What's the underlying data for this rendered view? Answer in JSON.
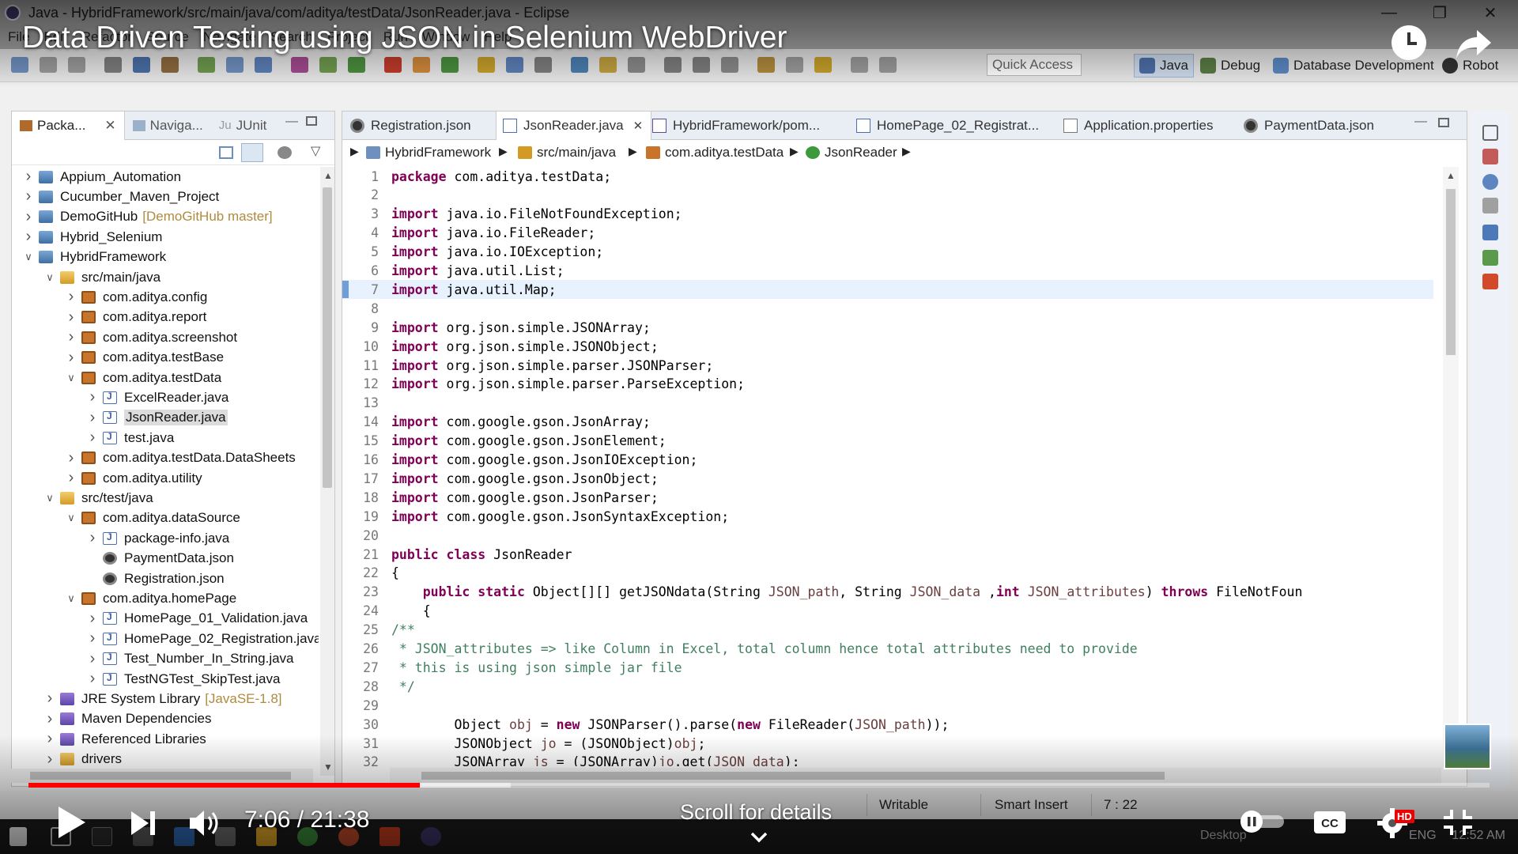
{
  "window": {
    "title": "Java - HybridFramework/src/main/java/com/aditya/testData/JsonReader.java - Eclipse"
  },
  "menu": [
    "File",
    "Edit",
    "Refactor",
    "Source",
    "Navigate",
    "Search",
    "Project",
    "Run",
    "Window",
    "Help"
  ],
  "toolbar": {
    "quick_access_placeholder": "Quick Access",
    "perspectives": [
      "Java",
      "Debug",
      "Database Development",
      "Robot"
    ]
  },
  "left_panel": {
    "tabs": [
      "Packa...",
      "Naviga...",
      "JUnit"
    ],
    "tree": [
      {
        "label": "Appium_Automation",
        "icon": "project-icon",
        "depth": 0,
        "twisty": "collapsed"
      },
      {
        "label": "Cucumber_Maven_Project",
        "icon": "project-icon",
        "depth": 0,
        "twisty": "collapsed"
      },
      {
        "label": "DemoGitHub",
        "decor": "[DemoGitHub master]",
        "icon": "project-icon",
        "depth": 0,
        "twisty": "collapsed"
      },
      {
        "label": "Hybrid_Selenium",
        "icon": "project-icon",
        "depth": 0,
        "twisty": "collapsed"
      },
      {
        "label": "HybridFramework",
        "icon": "project-icon",
        "depth": 0,
        "twisty": "expanded"
      },
      {
        "label": "src/main/java",
        "icon": "folder-icon",
        "depth": 1,
        "twisty": "expanded"
      },
      {
        "label": "com.aditya.config",
        "icon": "package-icon",
        "depth": 2,
        "twisty": "collapsed"
      },
      {
        "label": "com.aditya.report",
        "icon": "package-icon",
        "depth": 2,
        "twisty": "collapsed"
      },
      {
        "label": "com.aditya.screenshot",
        "icon": "package-icon",
        "depth": 2,
        "twisty": "collapsed"
      },
      {
        "label": "com.aditya.testBase",
        "icon": "package-icon",
        "depth": 2,
        "twisty": "collapsed"
      },
      {
        "label": "com.aditya.testData",
        "icon": "package-icon",
        "depth": 2,
        "twisty": "expanded"
      },
      {
        "label": "ExcelReader.java",
        "icon": "java-file-icon",
        "depth": 3,
        "twisty": "collapsed"
      },
      {
        "label": "JsonReader.java",
        "icon": "java-file-icon",
        "depth": 3,
        "twisty": "collapsed",
        "selected": true
      },
      {
        "label": "test.java",
        "icon": "java-file-icon",
        "depth": 3,
        "twisty": "collapsed"
      },
      {
        "label": "com.aditya.testData.DataSheets",
        "icon": "package-icon",
        "depth": 2,
        "twisty": "collapsed"
      },
      {
        "label": "com.aditya.utility",
        "icon": "package-icon",
        "depth": 2,
        "twisty": "collapsed"
      },
      {
        "label": "src/test/java",
        "icon": "folder-icon",
        "depth": 1,
        "twisty": "expanded"
      },
      {
        "label": "com.aditya.dataSource",
        "icon": "package-icon",
        "depth": 2,
        "twisty": "expanded"
      },
      {
        "label": "package-info.java",
        "icon": "java-file-icon",
        "depth": 3,
        "twisty": "collapsed"
      },
      {
        "label": "PaymentData.json",
        "icon": "json-file-icon",
        "depth": 3,
        "twisty": "none"
      },
      {
        "label": "Registration.json",
        "icon": "json-file-icon",
        "depth": 3,
        "twisty": "none"
      },
      {
        "label": "com.aditya.homePage",
        "icon": "package-icon",
        "depth": 2,
        "twisty": "expanded"
      },
      {
        "label": "HomePage_01_Validation.java",
        "icon": "java-file-icon",
        "depth": 3,
        "twisty": "collapsed"
      },
      {
        "label": "HomePage_02_Registration.java",
        "icon": "java-file-icon",
        "depth": 3,
        "twisty": "collapsed"
      },
      {
        "label": "Test_Number_In_String.java",
        "icon": "java-file-icon",
        "depth": 3,
        "twisty": "collapsed"
      },
      {
        "label": "TestNGTest_SkipTest.java",
        "icon": "java-file-icon",
        "depth": 3,
        "twisty": "collapsed"
      },
      {
        "label": "JRE System Library",
        "decor": "[JavaSE-1.8]",
        "icon": "library-icon",
        "depth": 1,
        "twisty": "collapsed"
      },
      {
        "label": "Maven Dependencies",
        "icon": "library-icon",
        "depth": 1,
        "twisty": "collapsed"
      },
      {
        "label": "Referenced Libraries",
        "icon": "library-icon",
        "depth": 1,
        "twisty": "collapsed"
      },
      {
        "label": "drivers",
        "icon": "folder-icon",
        "depth": 1,
        "twisty": "collapsed"
      }
    ]
  },
  "editor": {
    "tabs": [
      {
        "label": "Registration.json",
        "icon": "json-file-icon",
        "active": false
      },
      {
        "label": "JsonReader.java",
        "icon": "java-file-icon",
        "active": true
      },
      {
        "label": "HybridFramework/pom...",
        "icon": "pom-file-icon",
        "active": false
      },
      {
        "label": "HomePage_02_Registrat...",
        "icon": "java-file-icon",
        "active": false
      },
      {
        "label": "Application.properties",
        "icon": "properties-file-icon",
        "active": false
      },
      {
        "label": "PaymentData.json",
        "icon": "json-file-icon",
        "active": false
      }
    ],
    "breadcrumb": [
      "HybridFramework",
      "src/main/java",
      "com.aditya.testData",
      "JsonReader"
    ],
    "highlighted_line": 7,
    "code": [
      [
        {
          "t": "package",
          "c": "kw"
        },
        {
          "t": " com.aditya.testData;"
        }
      ],
      [],
      [
        {
          "t": "import",
          "c": "kw"
        },
        {
          "t": " java.io.FileNotFoundException;"
        }
      ],
      [
        {
          "t": "import",
          "c": "kw"
        },
        {
          "t": " java.io.FileReader;"
        }
      ],
      [
        {
          "t": "import",
          "c": "kw"
        },
        {
          "t": " java.io.IOException;"
        }
      ],
      [
        {
          "t": "import",
          "c": "kw"
        },
        {
          "t": " java.util.List;"
        }
      ],
      [
        {
          "t": "import",
          "c": "kw"
        },
        {
          "t": " java.util.Map;"
        }
      ],
      [],
      [
        {
          "t": "import",
          "c": "kw"
        },
        {
          "t": " org.json.simple.JSONArray;"
        }
      ],
      [
        {
          "t": "import",
          "c": "kw"
        },
        {
          "t": " org.json.simple.JSONObject;"
        }
      ],
      [
        {
          "t": "import",
          "c": "kw"
        },
        {
          "t": " org.json.simple.parser.JSONParser;"
        }
      ],
      [
        {
          "t": "import",
          "c": "kw"
        },
        {
          "t": " org.json.simple.parser.ParseException;"
        }
      ],
      [],
      [
        {
          "t": "import",
          "c": "kw"
        },
        {
          "t": " com.google.gson.JsonArray;"
        }
      ],
      [
        {
          "t": "import",
          "c": "kw"
        },
        {
          "t": " com.google.gson.JsonElement;"
        }
      ],
      [
        {
          "t": "import",
          "c": "kw"
        },
        {
          "t": " com.google.gson.JsonIOException;"
        }
      ],
      [
        {
          "t": "import",
          "c": "kw"
        },
        {
          "t": " com.google.gson.JsonObject;"
        }
      ],
      [
        {
          "t": "import",
          "c": "kw"
        },
        {
          "t": " com.google.gson.JsonParser;"
        }
      ],
      [
        {
          "t": "import",
          "c": "kw"
        },
        {
          "t": " com.google.gson.JsonSyntaxException;"
        }
      ],
      [],
      [
        {
          "t": "public class",
          "c": "kw"
        },
        {
          "t": " JsonReader"
        }
      ],
      [
        {
          "t": "{"
        }
      ],
      [
        {
          "t": "    "
        },
        {
          "t": "public static",
          "c": "kw"
        },
        {
          "t": " Object[][] getJSONdata(String "
        },
        {
          "t": "JSON_path",
          "c": "pm"
        },
        {
          "t": ", String "
        },
        {
          "t": "JSON_data",
          "c": "pm"
        },
        {
          "t": " ,"
        },
        {
          "t": "int",
          "c": "kw"
        },
        {
          "t": " "
        },
        {
          "t": "JSON_attributes",
          "c": "pm"
        },
        {
          "t": ") "
        },
        {
          "t": "throws",
          "c": "kw"
        },
        {
          "t": " FileNotFoun"
        }
      ],
      [
        {
          "t": "    {"
        }
      ],
      [
        {
          "t": "/**",
          "c": "cm"
        }
      ],
      [
        {
          "t": " * JSON_attributes => like Column in Excel, total column hence total attributes need to provide",
          "c": "cm"
        }
      ],
      [
        {
          "t": " * this is using json simple jar file",
          "c": "cm"
        }
      ],
      [
        {
          "t": " */",
          "c": "cm"
        }
      ],
      [],
      [
        {
          "t": "        Object "
        },
        {
          "t": "obj",
          "c": "pm"
        },
        {
          "t": " = "
        },
        {
          "t": "new",
          "c": "kw"
        },
        {
          "t": " JSONParser().parse("
        },
        {
          "t": "new",
          "c": "kw"
        },
        {
          "t": " FileReader("
        },
        {
          "t": "JSON_path",
          "c": "pm"
        },
        {
          "t": "));"
        }
      ],
      [
        {
          "t": "        JSONObject "
        },
        {
          "t": "jo",
          "c": "pm"
        },
        {
          "t": " = (JSONObject)"
        },
        {
          "t": "obj",
          "c": "pm"
        },
        {
          "t": ";"
        }
      ],
      [
        {
          "t": "        JSONArray "
        },
        {
          "t": "js",
          "c": "pm"
        },
        {
          "t": " = (JSONArray)"
        },
        {
          "t": "jo",
          "c": "pm"
        },
        {
          "t": ".get("
        },
        {
          "t": "JSON_data",
          "c": "pm"
        },
        {
          "t": ");"
        }
      ]
    ]
  },
  "status": {
    "writable": "Writable",
    "insert_mode": "Smart Insert",
    "position": "7 : 22"
  },
  "taskbar": {
    "desktop_label": "Desktop",
    "language": "ENG",
    "clock": "12:52 AM"
  },
  "video": {
    "title": "Data Driven Testing using JSON in Selenium WebDriver",
    "time": "7:06 / 21:38",
    "scroll_hint": "Scroll for details",
    "hd_badge": "HD",
    "progress_fraction": 0.268,
    "buffered_fraction": 0.33
  },
  "colors": {
    "progress_played": "#ff0000",
    "keyword": "#7f0055",
    "comment": "#3f7f5f",
    "current_line": "#e8f2fe"
  }
}
